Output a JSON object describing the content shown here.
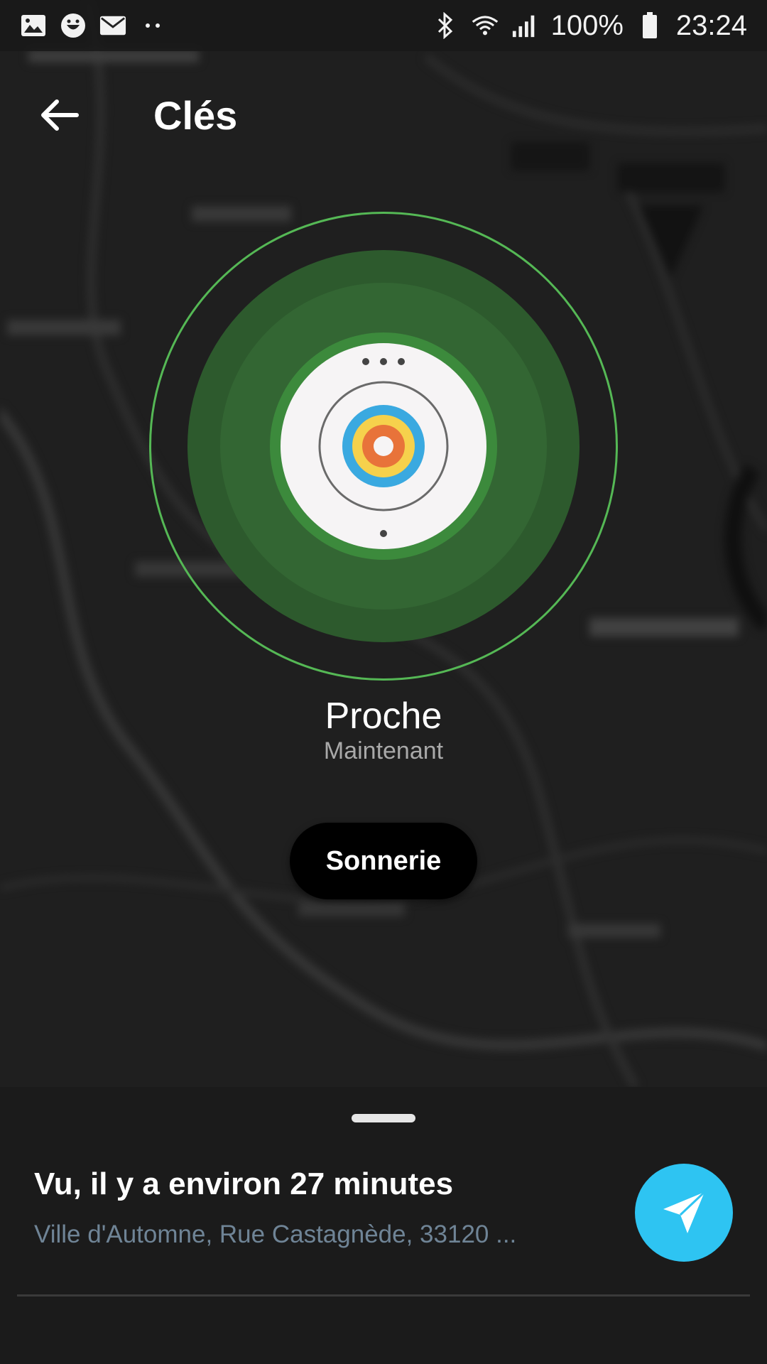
{
  "status_bar": {
    "left_icons": [
      "image-icon",
      "smiley-icon",
      "mail-icon",
      "more-dots-icon"
    ],
    "right_icons": [
      "bluetooth-icon",
      "wifi-icon",
      "signal-icon",
      "battery-icon"
    ],
    "battery": "100%",
    "time": "23:24"
  },
  "app_bar": {
    "back_icon": "arrow-left-icon",
    "title": "Clés"
  },
  "radar": {
    "colors": {
      "ring": "#55b855",
      "fill_outer": "#2d5a2d",
      "fill_inner": "#336633"
    }
  },
  "proximity": {
    "status": "Proche",
    "time": "Maintenant"
  },
  "ring_button": {
    "label": "Sonnerie"
  },
  "sheet": {
    "last_seen": "Vu, il y a environ 27 minutes",
    "address": "Ville d'Automne, Rue Castagnède, 33120 ...",
    "directions_icon": "navigation-arrow-icon",
    "accent": "#2ec4f2"
  }
}
